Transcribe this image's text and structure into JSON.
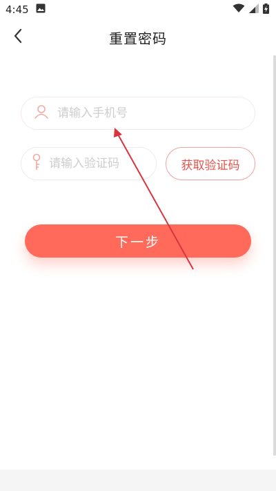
{
  "status_bar": {
    "time": "4:45",
    "icons": [
      "image-icon",
      "wifi-icon",
      "signal-icon",
      "battery-charging-icon"
    ]
  },
  "header": {
    "title": "重置密码",
    "back_icon": "chevron-left-icon"
  },
  "form": {
    "phone": {
      "placeholder": "请输入手机号",
      "value": "",
      "icon": "user-icon"
    },
    "code": {
      "placeholder": "请输入验证码",
      "value": "",
      "icon": "key-icon"
    },
    "get_code_label": "获取验证码",
    "next_label": "下一步"
  },
  "colors": {
    "accent": "#ff6a5b",
    "accent_text": "#e8524a",
    "icon_pink": "#f3a9a4",
    "annotation": "#d9343e"
  }
}
